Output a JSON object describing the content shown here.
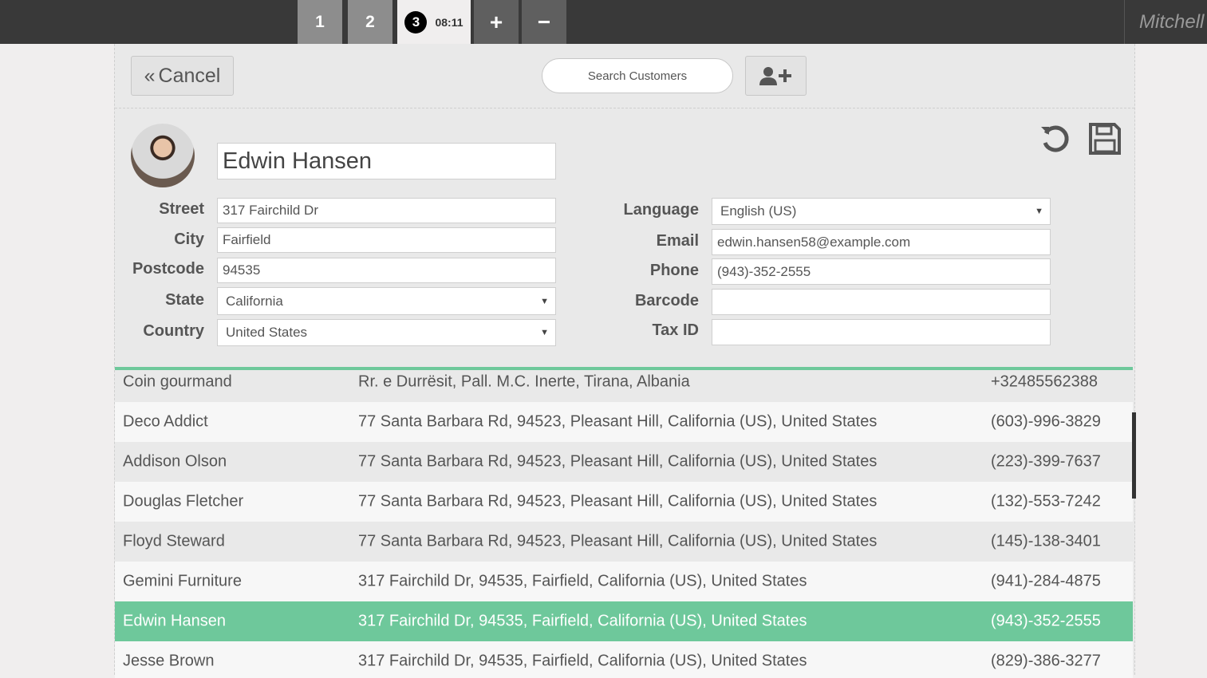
{
  "topbar": {
    "tabs": [
      "1",
      "2"
    ],
    "active_tab": {
      "number": "3",
      "time": "08:11"
    },
    "add_label": "+",
    "remove_label": "−",
    "user": "Mitchell Admin"
  },
  "toolbar": {
    "cancel_label": "Cancel",
    "search_placeholder": "Search Customers"
  },
  "customer": {
    "name": "Edwin Hansen",
    "labels": {
      "street": "Street",
      "city": "City",
      "postcode": "Postcode",
      "state": "State",
      "country": "Country",
      "language": "Language",
      "email": "Email",
      "phone": "Phone",
      "barcode": "Barcode",
      "taxid": "Tax ID"
    },
    "street": "317 Fairchild Dr",
    "city": "Fairfield",
    "postcode": "94535",
    "state": "California",
    "country": "United States",
    "language": "English (US)",
    "email": "edwin.hansen58@example.com",
    "phone": "(943)-352-2555",
    "barcode": "",
    "taxid": ""
  },
  "customers": [
    {
      "name": "Coin gourmand",
      "address": "Rr. e Durrësit, Pall. M.C. Inerte, Tirana, Albania",
      "phone": "+32485562388"
    },
    {
      "name": "Deco Addict",
      "address": "77 Santa Barbara Rd, 94523, Pleasant Hill, California (US), United States",
      "phone": "(603)-996-3829"
    },
    {
      "name": "Addison Olson",
      "address": "77 Santa Barbara Rd, 94523, Pleasant Hill, California (US), United States",
      "phone": "(223)-399-7637"
    },
    {
      "name": "Douglas Fletcher",
      "address": "77 Santa Barbara Rd, 94523, Pleasant Hill, California (US), United States",
      "phone": "(132)-553-7242"
    },
    {
      "name": "Floyd Steward",
      "address": "77 Santa Barbara Rd, 94523, Pleasant Hill, California (US), United States",
      "phone": "(145)-138-3401"
    },
    {
      "name": "Gemini Furniture",
      "address": "317 Fairchild Dr, 94535, Fairfield, California (US), United States",
      "phone": "(941)-284-4875"
    },
    {
      "name": "Edwin Hansen",
      "address": "317 Fairchild Dr, 94535, Fairfield, California (US), United States",
      "phone": "(943)-352-2555"
    },
    {
      "name": "Jesse Brown",
      "address": "317 Fairchild Dr, 94535, Fairfield, California (US), United States",
      "phone": "(829)-386-3277"
    }
  ],
  "selected_customer": "Edwin Hansen",
  "colors": {
    "accent": "#6ec89b",
    "topbar": "#393939"
  }
}
